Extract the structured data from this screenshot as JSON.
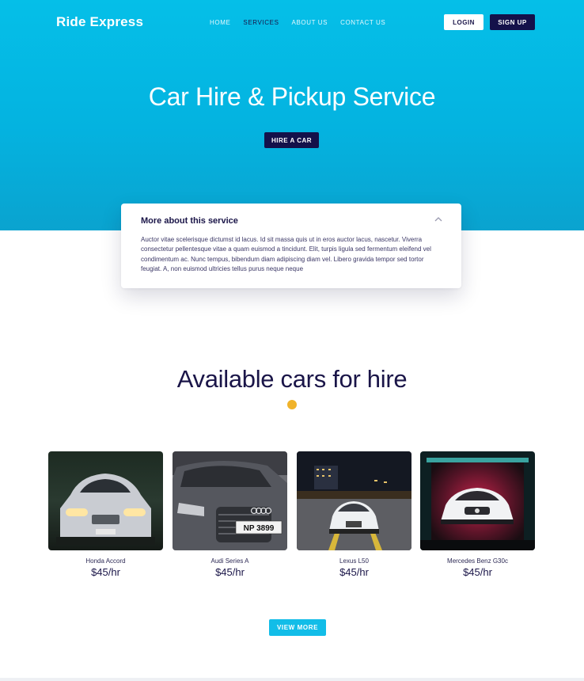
{
  "brand": {
    "logo_text": "Ride Express",
    "accent": "#05bfe8",
    "dark": "#14114a",
    "highlight": "#f0b32a"
  },
  "nav": {
    "items": [
      {
        "label": "HOME",
        "active": false
      },
      {
        "label": "SERVICES",
        "active": true
      },
      {
        "label": "ABOUT US",
        "active": false
      },
      {
        "label": "CONTACT US",
        "active": false
      }
    ],
    "login_label": "LOGIN",
    "signup_label": "SIGN UP"
  },
  "hero": {
    "title": "Car Hire & Pickup Service",
    "cta_label": "HIRE A CAR"
  },
  "info_card": {
    "title": "More about this service",
    "toggle_icon": "chevron-up-icon",
    "body": "Auctor vitae scelerisque dictumst id lacus. Id sit massa quis ut in eros auctor lacus, nascetur. Viverra consectetur pellentesque vitae a quam euismod a tincidunt. Elit, turpis ligula sed fermentum eleifend vel condimentum ac. Nunc tempus, bibendum diam adipiscing diam vel. Libero gravida tempor sed tortor feugiat. A, non euismod ultricies tellus purus neque neque"
  },
  "cars_section": {
    "title": "Available cars for hire",
    "cars": [
      {
        "name": "Honda Accord",
        "price": "$45/hr"
      },
      {
        "name": "Audi Series A",
        "price": "$45/hr",
        "plate": "NP 3899"
      },
      {
        "name": "Lexus L50",
        "price": "$45/hr"
      },
      {
        "name": "Mercedes Benz G30c",
        "price": "$45/hr"
      }
    ],
    "view_more_label": "VIEW MORE"
  }
}
